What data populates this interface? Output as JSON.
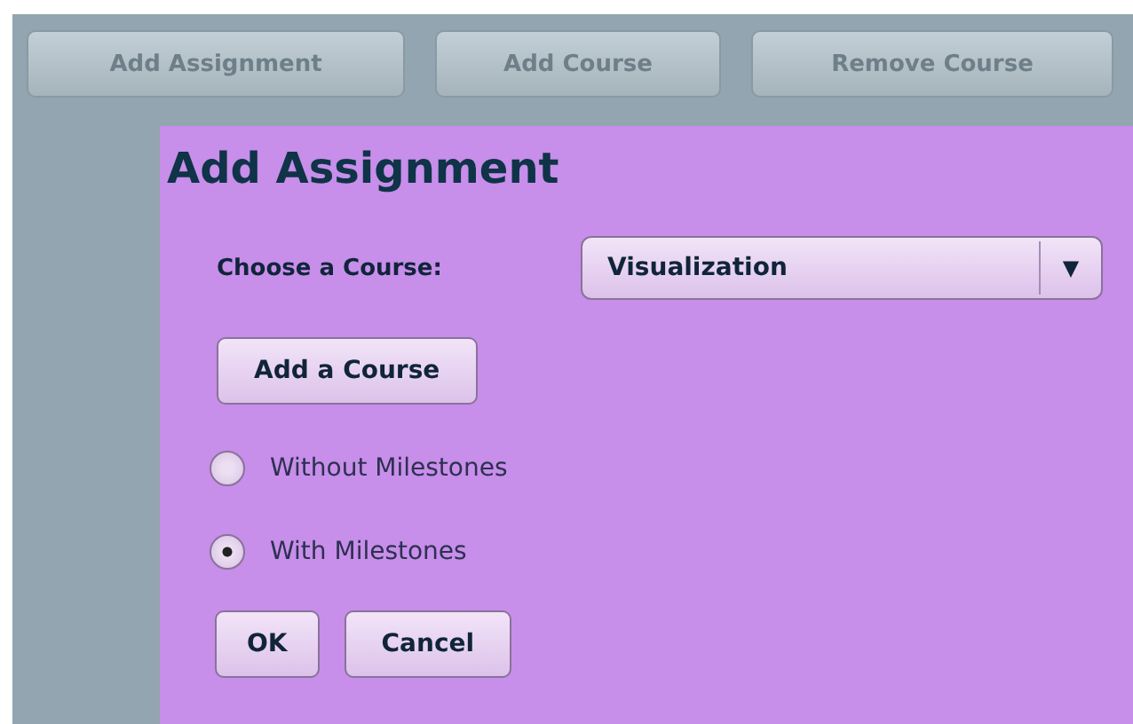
{
  "toolbar": [
    {
      "label": "Add Assignment",
      "disabled": true
    },
    {
      "label": "Add Course",
      "disabled": true
    },
    {
      "label": "Remove Course",
      "disabled": true
    }
  ],
  "dialog": {
    "title": "Add Assignment",
    "course": {
      "label": "Choose a Course:",
      "value": "Visualization",
      "arrow": "▼"
    },
    "add_course_button": "Add a Course",
    "options": [
      {
        "label": "Without Milestones",
        "selected": false
      },
      {
        "label": "With Milestones",
        "selected": true
      }
    ],
    "buttons": [
      "OK",
      "Cancel"
    ]
  }
}
